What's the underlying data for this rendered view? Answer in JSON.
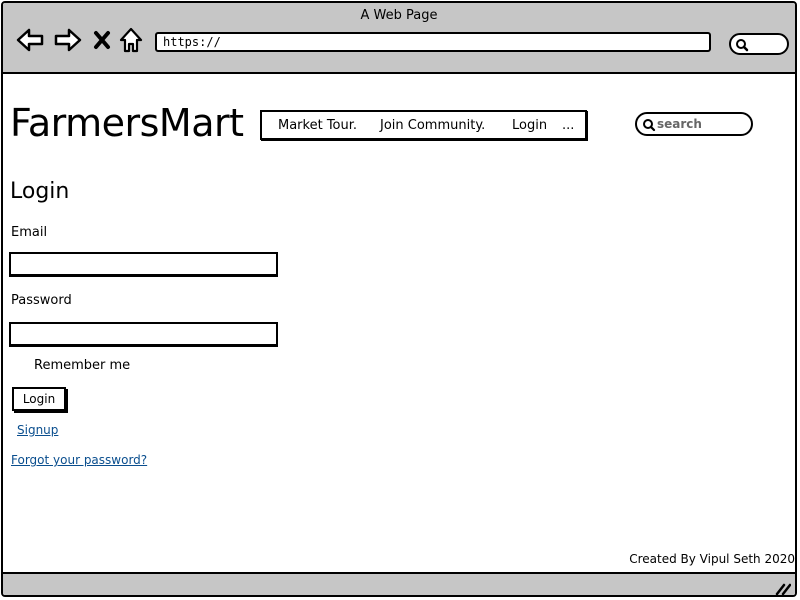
{
  "window": {
    "title": "A Web Page",
    "url": "https://"
  },
  "icons": {
    "back": "back-arrow-icon",
    "forward": "forward-arrow-icon",
    "stop": "close-icon",
    "home": "home-icon",
    "search": "search-icon",
    "resize": "resize-grip-icon"
  },
  "site": {
    "logo": "FarmersMart",
    "menu": [
      {
        "label": "Market Tour."
      },
      {
        "label": "Join Community."
      },
      {
        "label": "Login"
      },
      {
        "label": "..."
      }
    ],
    "search_placeholder": "search"
  },
  "login_form": {
    "heading": "Login",
    "email_label": "Email",
    "email_value": "",
    "password_label": "Password",
    "password_value": "",
    "remember_label": "Remember me",
    "login_button": "Login",
    "signup_link": "Signup",
    "forgot_link": "Forgot your password?"
  },
  "footer": {
    "credit": "Created By Vipul Seth 2020"
  },
  "colors": {
    "chrome": "#c6c6c6",
    "link": "#0a4e8e",
    "border": "#000000"
  }
}
